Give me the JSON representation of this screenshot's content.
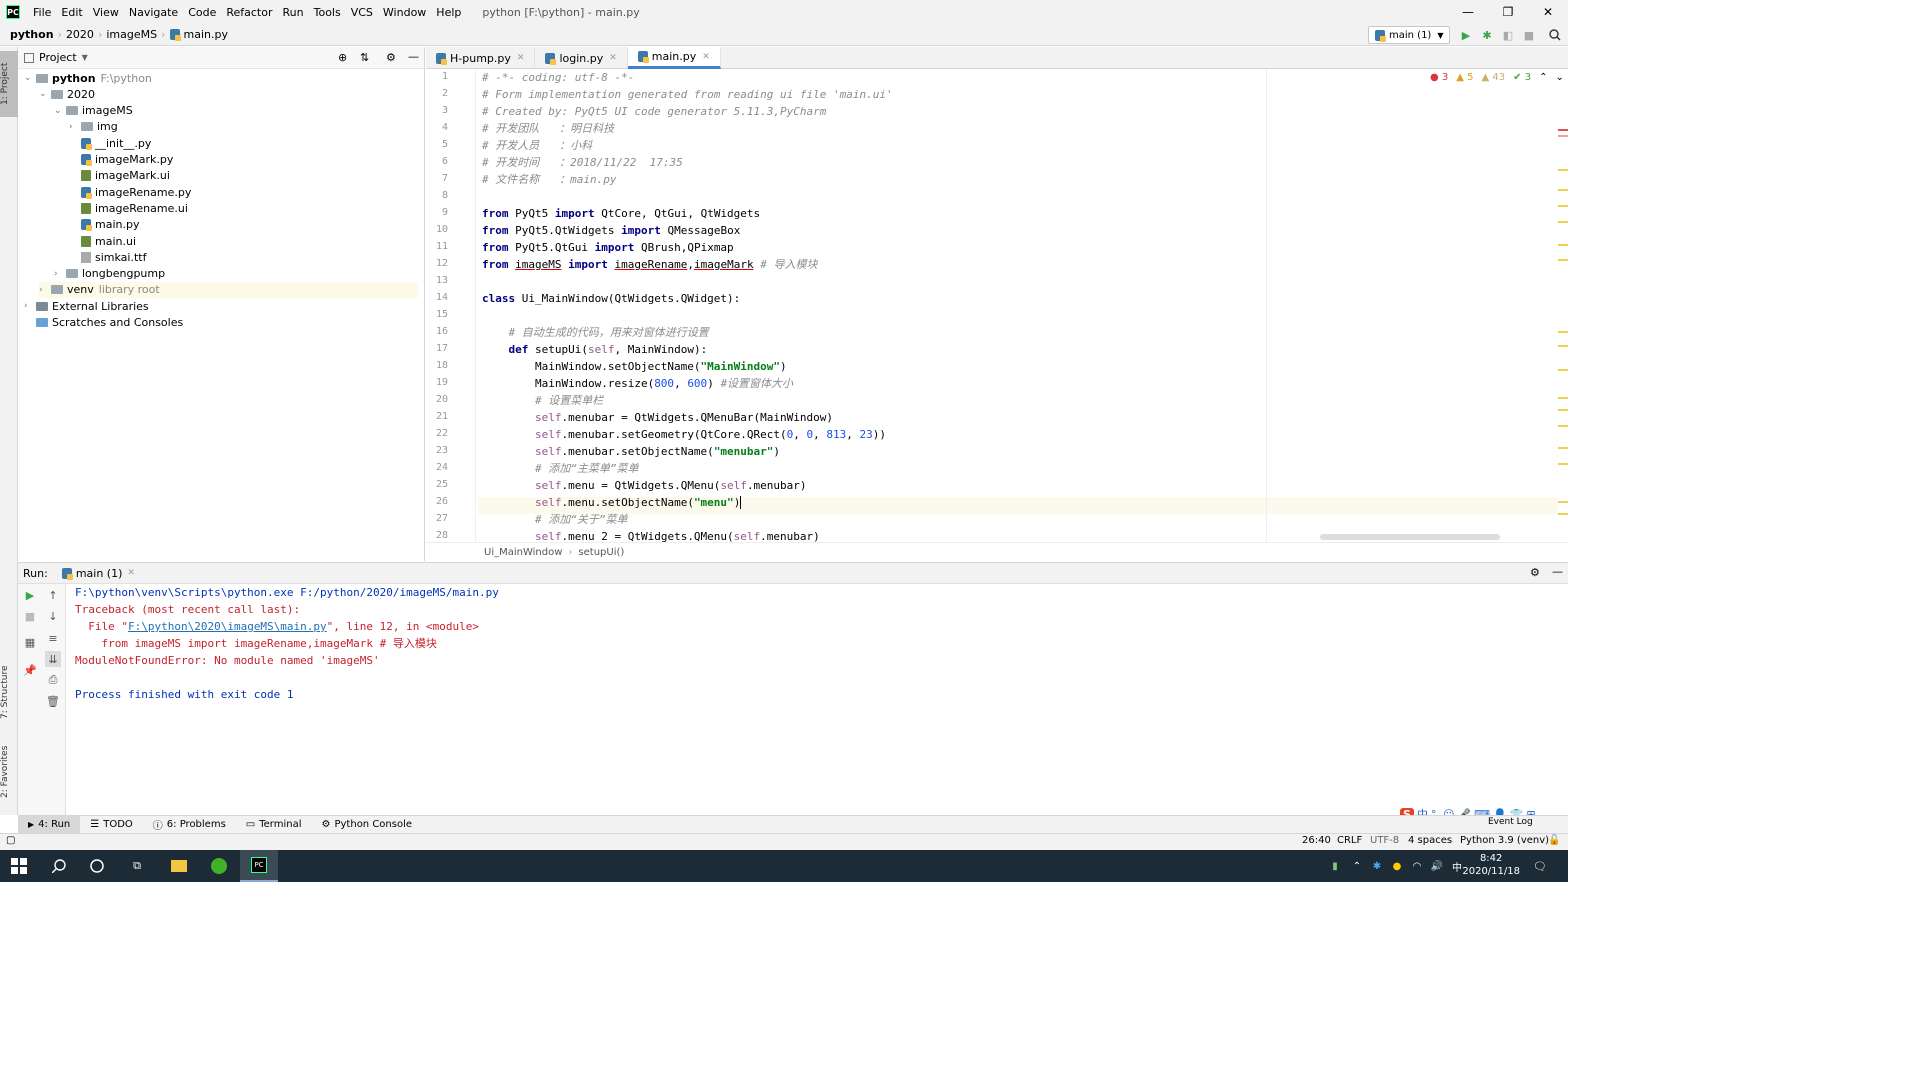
{
  "menubar": {
    "logo": "PC",
    "items": [
      "File",
      "Edit",
      "View",
      "Navigate",
      "Code",
      "Refactor",
      "Run",
      "Tools",
      "VCS",
      "Window",
      "Help"
    ],
    "window_title": "python [F:\\python] - main.py"
  },
  "navbar": {
    "crumbs": [
      "python",
      "2020",
      "imageMS",
      "main.py"
    ],
    "run_config": "main (1)"
  },
  "left_stripe": {
    "project_tab": "1: Project",
    "structure_tab": "7: Structure",
    "favorites_tab": "2: Favorites"
  },
  "project": {
    "header": "Project",
    "tree": [
      {
        "label": "python",
        "note": "F:\\python",
        "type": "folder",
        "depth": 0,
        "expanded": true
      },
      {
        "label": "2020",
        "note": "",
        "type": "folder",
        "depth": 1,
        "expanded": true
      },
      {
        "label": "imageMS",
        "note": "",
        "type": "folder",
        "depth": 2,
        "expanded": true
      },
      {
        "label": "img",
        "note": "",
        "type": "folder",
        "depth": 3,
        "expanded": false
      },
      {
        "label": "__init__.py",
        "note": "",
        "type": "py",
        "depth": 3
      },
      {
        "label": "imageMark.py",
        "note": "",
        "type": "py",
        "depth": 3
      },
      {
        "label": "imageMark.ui",
        "note": "",
        "type": "ui",
        "depth": 3
      },
      {
        "label": "imageRename.py",
        "note": "",
        "type": "py",
        "depth": 3
      },
      {
        "label": "imageRename.ui",
        "note": "",
        "type": "ui",
        "depth": 3
      },
      {
        "label": "main.py",
        "note": "",
        "type": "py",
        "depth": 3
      },
      {
        "label": "main.ui",
        "note": "",
        "type": "ui",
        "depth": 3
      },
      {
        "label": "simkai.ttf",
        "note": "",
        "type": "ttf",
        "depth": 3
      },
      {
        "label": "longbengpump",
        "note": "",
        "type": "folder",
        "depth": 2,
        "expanded": false
      },
      {
        "label": "venv",
        "note": "library root",
        "type": "folder",
        "depth": 1,
        "expanded": false
      },
      {
        "label": "External Libraries",
        "note": "",
        "type": "lib",
        "depth": 0,
        "expanded": false
      },
      {
        "label": "Scratches and Consoles",
        "note": "",
        "type": "scratch",
        "depth": 0
      }
    ]
  },
  "editor": {
    "tabs": [
      {
        "label": "H-pump.py",
        "active": false
      },
      {
        "label": "login.py",
        "active": false
      },
      {
        "label": "main.py",
        "active": true
      }
    ],
    "inspections": {
      "errors": "3",
      "warnings": "5",
      "weak": "43",
      "ok": "3"
    },
    "line_numbers": [
      "1",
      "2",
      "3",
      "4",
      "5",
      "6",
      "7",
      "8",
      "9",
      "10",
      "11",
      "12",
      "13",
      "14",
      "15",
      "16",
      "17",
      "18",
      "19",
      "20",
      "21",
      "22",
      "23",
      "24",
      "25",
      "26",
      "27",
      "28"
    ],
    "breadcrumb": [
      "Ui_MainWindow",
      "setupUi()"
    ]
  },
  "run": {
    "label": "Run:",
    "tab": "main (1)",
    "output": [
      "F:\\python\\venv\\Scripts\\python.exe F:/python/2020/imageMS/main.py",
      "Traceback (most recent call last):",
      "  File \"",
      "F:\\python\\2020\\imageMS\\main.py",
      "\", line 12, in <module>",
      "    from imageMS import imageRename,imageMark # 导入模块",
      "ModuleNotFoundError: No module named 'imageMS'",
      "Process finished with exit code 1"
    ]
  },
  "tool_tabs": [
    "4: Run",
    "TODO",
    "6: Problems",
    "Terminal",
    "Python Console"
  ],
  "event_log": "Event Log",
  "status": {
    "position": "26:40",
    "line_sep": "CRLF",
    "encoding": "UTF-8",
    "indent": "4 spaces",
    "interpreter": "Python 3.9 (venv)"
  },
  "taskbar": {
    "time": "8:42",
    "date": "2020/11/18",
    "ime_lang": "中"
  }
}
